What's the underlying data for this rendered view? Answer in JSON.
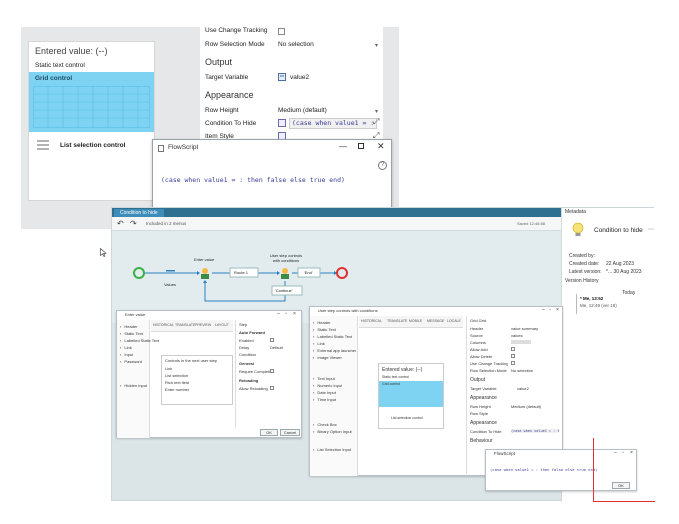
{
  "top": {
    "entered_title": "Entered value: (--)",
    "static_control": "Static text control",
    "grid_control": "Grid control",
    "list_control": "List selection control",
    "props": {
      "use_change_tracking": "Use Change Tracking",
      "row_selection_mode": "Row Selection Mode",
      "row_selection_value": "No selection",
      "output_header": "Output",
      "target_variable": "Target Variable",
      "target_variable_value": "value2",
      "appearance_header": "Appearance",
      "row_height": "Row Height",
      "row_height_value": "Medium (default)",
      "condition_to_hide": "Condition To Hide",
      "condition_value": "(case when value1 = : th",
      "item_style": "Item Style"
    },
    "flowscript": {
      "title": "FlowScript",
      "minimize": "—",
      "close": "✕",
      "help": "?",
      "code": "(case when value1 = : then false else true end)"
    }
  },
  "big": {
    "tab_label": "Condition to hide",
    "included_text": "Included in 2 menus",
    "saved_text": "Saved 12:46:58",
    "undo_icon": "↶",
    "redo_icon": "↷",
    "flow": {
      "enter_value": "Enter value",
      "user_step_label": "User step controls with conditions",
      "values": "Values",
      "route_1": "Route 1",
      "end_label": "'End'",
      "continue_label": "'Continue'"
    },
    "metadata": {
      "panel_title": "Metadata",
      "name": "Condition to hide",
      "created_by_label": "Created by:",
      "created_date_label": "Created date:",
      "created_date_value": "22 Aug 2023",
      "latest_version_label": "Latest version:",
      "latest_version_value": "*... 30 Aug 2023",
      "version_history_title": "Version History",
      "today_label": "Today",
      "version_1": "* Me, 13:52",
      "version_2": "Me, 12:49 (ver 18)"
    },
    "left_window": {
      "title": "Enter value",
      "tools": [
        "Header",
        "Static Text",
        "Labelled Static Text",
        "Link",
        "Input",
        "Password",
        "Hidden Input"
      ],
      "ribbon": [
        "HISTORICAL",
        "TRANSLATE",
        "PREVIEW",
        "LAYOUT"
      ],
      "step_header": "Step",
      "auto_forward": "Auto Forward",
      "enabled": "Enabled",
      "delay": "Delay",
      "delay_value": "Default",
      "condition": "Condition",
      "general": "General",
      "require_completion": "Require Completion",
      "reloading": "Reloading",
      "allow_reloading": "Allow Reloading",
      "canvas_title": "Controls in the next user step",
      "canvas_items": [
        "Link",
        "List selection",
        "Rich text field",
        "Enter number"
      ],
      "ok": "OK",
      "cancel": "Cancel"
    },
    "right_window": {
      "title": "User step controls with conditions",
      "tools": [
        "Header",
        "Static Text",
        "Labelled Static Text",
        "Link",
        "External app launcher",
        "Image Viewer",
        "Text Input",
        "Numeric Input",
        "Date Input",
        "Time Input",
        "Check Box",
        "Binary Option Input",
        "List Selection Input"
      ],
      "ribbon": [
        "HISTORICAL",
        "TRANSLATE",
        "MOBILE",
        "MESSAGE",
        "LOCALE"
      ],
      "grid_header": "Grid Grid",
      "props": [
        "Header",
        "Source",
        "Columns",
        "Allow Add",
        "Allow Delete",
        "Use Change Tracking",
        "Row Selection Mode"
      ],
      "prop_values": [
        "value summary",
        "values",
        "",
        "",
        "",
        "",
        "No selection"
      ],
      "output_header": "Output",
      "target_variable": "Target Variable",
      "target_value": "value2",
      "appearance_header": "Appearance",
      "row_height": "Row Height",
      "row_height_value": "Medium (default)",
      "row_style": "Row Style",
      "condition_to_hide": "Condition To Hide",
      "condition_value": "(case when value1 = : th",
      "behaviour": "Behaviour",
      "entered_value": "Entered value: (--)",
      "static_text": "Static text control",
      "grid_control": "Grid control",
      "list_control": "List selection control"
    },
    "small_flowscript": {
      "title": "FlowScript",
      "code": "(case when value1 = : then false else true end)",
      "ok": "OK"
    }
  },
  "colors": {
    "grid_blue": "#7dd3f1",
    "tab_dark": "#2f6f8f",
    "code_blue": "#3a3a9a",
    "start_green": "#3cb043",
    "end_red": "#e03030"
  }
}
